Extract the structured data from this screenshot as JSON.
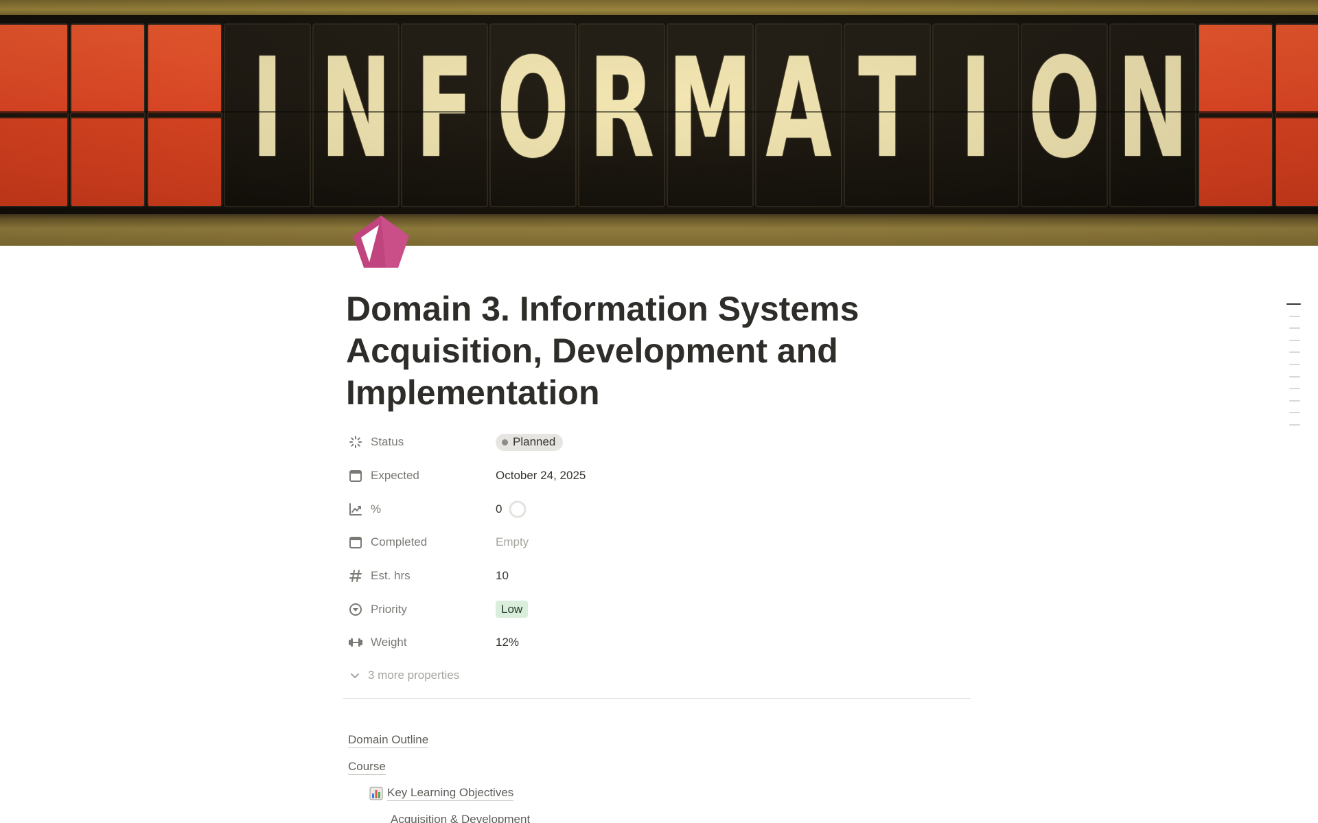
{
  "cover": {
    "letters": [
      "I",
      "N",
      "F",
      "O",
      "R",
      "M",
      "A",
      "T",
      "I",
      "O",
      "N"
    ],
    "colors": {
      "letter": "#f2e6b4",
      "panel_red": "#e74523",
      "panel_dark": "#100d09"
    }
  },
  "page": {
    "icon": "pentagon-icon",
    "icon_color": "#c0447e",
    "title": "Domain 3. Information Systems Acquisition, Development and Implementation"
  },
  "properties": [
    {
      "icon": "status-spinner-icon",
      "label": "Status",
      "value": "Planned",
      "type": "status",
      "dot_color": "#8e8b86"
    },
    {
      "icon": "calendar-icon",
      "label": "Expected",
      "value": "October 24, 2025",
      "type": "text"
    },
    {
      "icon": "trend-chart-icon",
      "label": "%",
      "value": "0",
      "type": "progress",
      "progress": 0
    },
    {
      "icon": "calendar-icon",
      "label": "Completed",
      "value": "Empty",
      "type": "empty"
    },
    {
      "icon": "hash-icon",
      "label": "Est. hrs",
      "value": "10",
      "type": "text"
    },
    {
      "icon": "priority-circle-icon",
      "label": "Priority",
      "value": "Low",
      "type": "tag",
      "tag_color": "#dbeddb"
    },
    {
      "icon": "dumbbell-icon",
      "label": "Weight",
      "value": "12%",
      "type": "text"
    }
  ],
  "more_properties": "3 more properties",
  "links": [
    {
      "text": "Domain Outline",
      "level": 0
    },
    {
      "text": "Course",
      "level": 0
    },
    {
      "text": "Key Learning Objectives",
      "level": 1,
      "emoji": "bar-chart-icon"
    },
    {
      "text": "Acquisition & Development",
      "level": 2
    }
  ],
  "toc": {
    "count": 11,
    "active_index": 0
  }
}
